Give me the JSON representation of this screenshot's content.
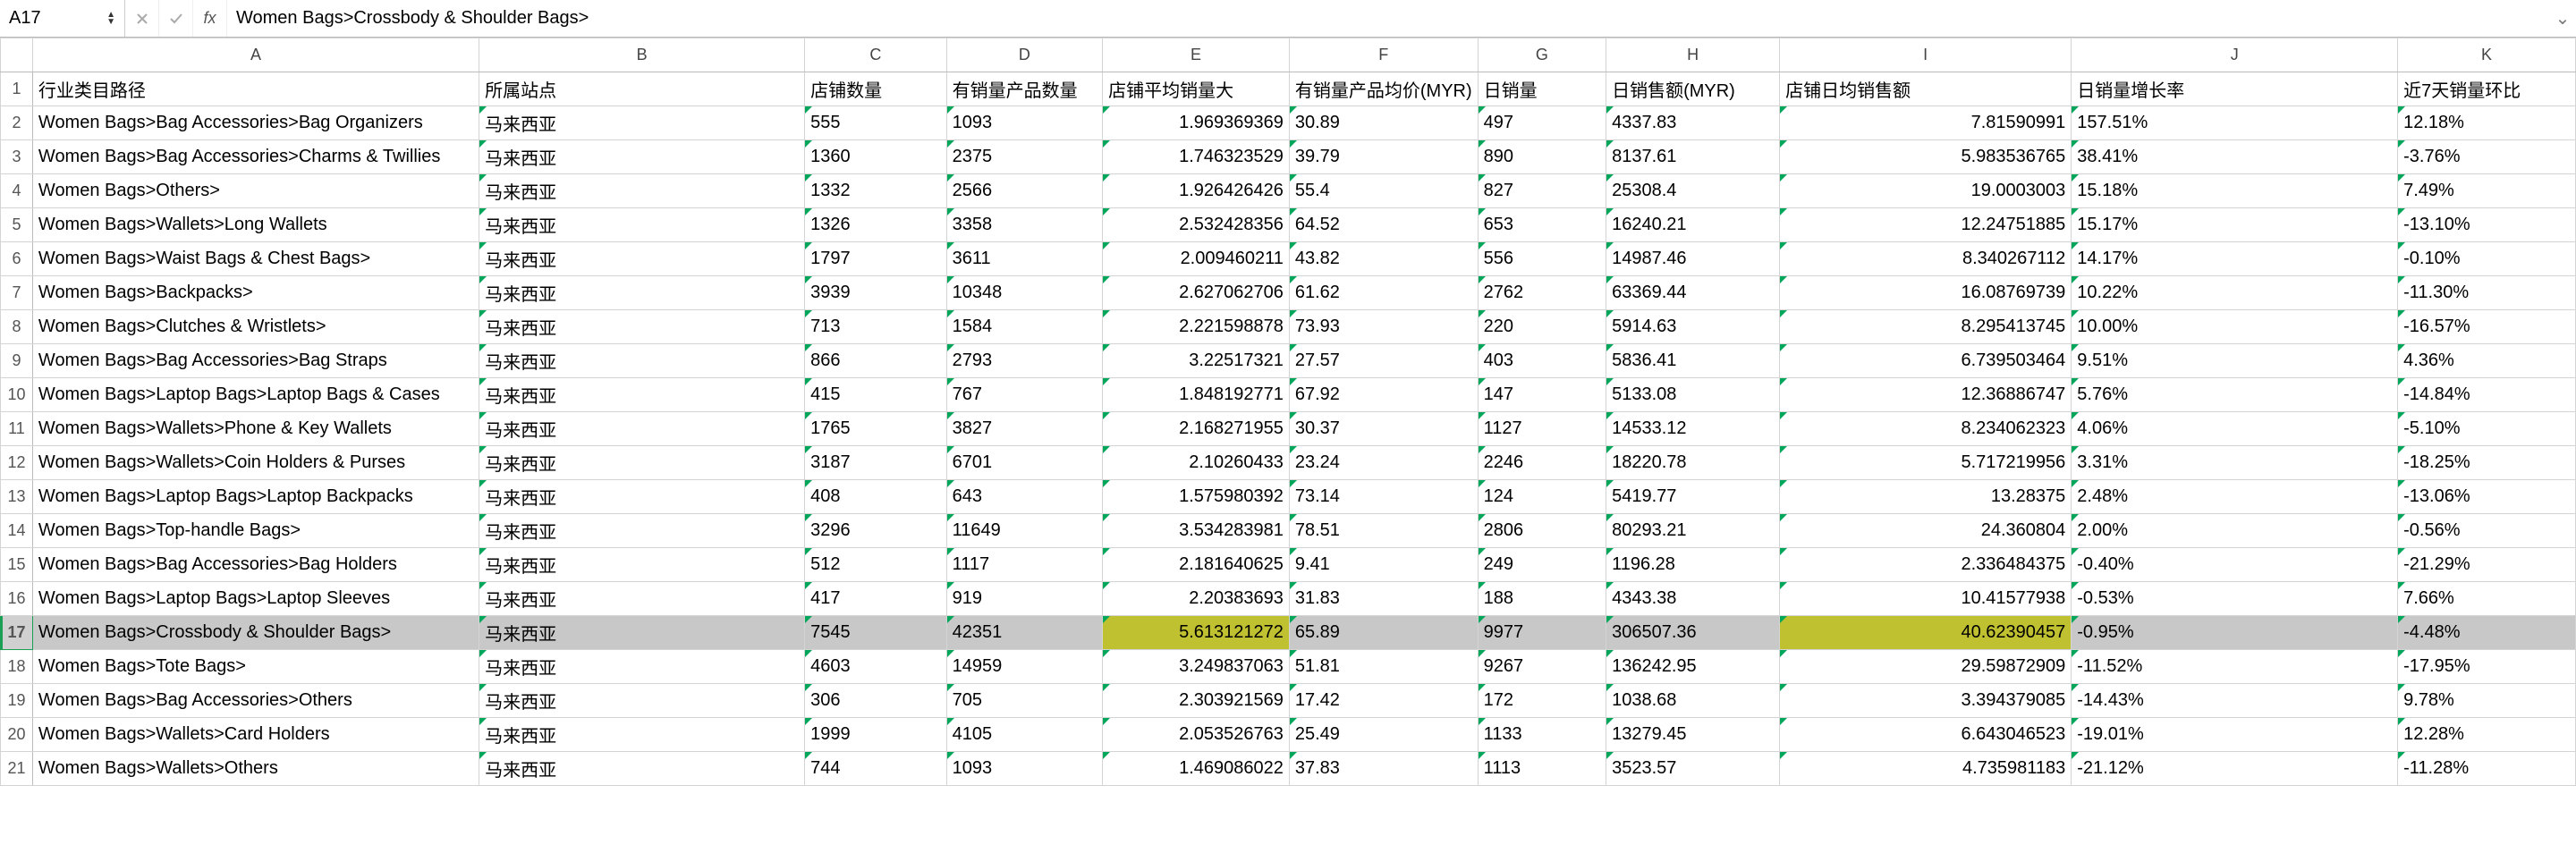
{
  "nameBox": "A17",
  "formula": "Women Bags>Crossbody & Shoulder Bags>",
  "columns": [
    "A",
    "B",
    "C",
    "D",
    "E",
    "F",
    "G",
    "H",
    "I",
    "J",
    "K"
  ],
  "headers": {
    "A": "行业类目路径",
    "B": "所属站点",
    "C": "店铺数量",
    "D": "有销量产品数量",
    "E": "店铺平均销量大",
    "F": "有销量产品均价(MYR)",
    "G": "日销量",
    "H": "日销售额(MYR)",
    "I": "店铺日均销售额",
    "J": "日销量增长率",
    "K": "近7天销量环比"
  },
  "selectedRow": 17,
  "highlightCols": [
    "E",
    "I"
  ],
  "rows": [
    {
      "n": 1,
      "A": "行业类目路径",
      "B": "所属站点",
      "C": "店铺数量",
      "D": "有销量产品数量",
      "E": "店铺平均销量大",
      "F": "有销量产品均价(MYR)",
      "G": "日销量",
      "H": "日销售额(MYR)",
      "I": "店铺日均销售额",
      "J": "日销量增长率",
      "K": "近7天销量环比",
      "isHeader": true
    },
    {
      "n": 2,
      "A": "Women Bags>Bag Accessories>Bag Organizers",
      "B": "马来西亚",
      "C": "555",
      "D": "1093",
      "E": "1.969369369",
      "F": "30.89",
      "G": "497",
      "H": "4337.83",
      "I": "7.81590991",
      "J": "157.51%",
      "K": "12.18%"
    },
    {
      "n": 3,
      "A": "Women Bags>Bag Accessories>Charms & Twillies",
      "B": "马来西亚",
      "C": "1360",
      "D": "2375",
      "E": "1.746323529",
      "F": "39.79",
      "G": "890",
      "H": "8137.61",
      "I": "5.983536765",
      "J": "38.41%",
      "K": "-3.76%"
    },
    {
      "n": 4,
      "A": "Women Bags>Others>",
      "B": "马来西亚",
      "C": "1332",
      "D": "2566",
      "E": "1.926426426",
      "F": "55.4",
      "G": "827",
      "H": "25308.4",
      "I": "19.0003003",
      "J": "15.18%",
      "K": "7.49%"
    },
    {
      "n": 5,
      "A": "Women Bags>Wallets>Long Wallets",
      "B": "马来西亚",
      "C": "1326",
      "D": "3358",
      "E": "2.532428356",
      "F": "64.52",
      "G": "653",
      "H": "16240.21",
      "I": "12.24751885",
      "J": "15.17%",
      "K": "-13.10%"
    },
    {
      "n": 6,
      "A": "Women Bags>Waist Bags & Chest Bags>",
      "B": "马来西亚",
      "C": "1797",
      "D": "3611",
      "E": "2.009460211",
      "F": "43.82",
      "G": "556",
      "H": "14987.46",
      "I": "8.340267112",
      "J": "14.17%",
      "K": "-0.10%"
    },
    {
      "n": 7,
      "A": "Women Bags>Backpacks>",
      "B": "马来西亚",
      "C": "3939",
      "D": "10348",
      "E": "2.627062706",
      "F": "61.62",
      "G": "2762",
      "H": "63369.44",
      "I": "16.08769739",
      "J": "10.22%",
      "K": "-11.30%"
    },
    {
      "n": 8,
      "A": "Women Bags>Clutches & Wristlets>",
      "B": "马来西亚",
      "C": "713",
      "D": "1584",
      "E": "2.221598878",
      "F": "73.93",
      "G": "220",
      "H": "5914.63",
      "I": "8.295413745",
      "J": "10.00%",
      "K": "-16.57%"
    },
    {
      "n": 9,
      "A": "Women Bags>Bag Accessories>Bag Straps",
      "B": "马来西亚",
      "C": "866",
      "D": "2793",
      "E": "3.22517321",
      "F": "27.57",
      "G": "403",
      "H": "5836.41",
      "I": "6.739503464",
      "J": "9.51%",
      "K": "4.36%"
    },
    {
      "n": 10,
      "A": "Women Bags>Laptop Bags>Laptop Bags & Cases",
      "B": "马来西亚",
      "C": "415",
      "D": "767",
      "E": "1.848192771",
      "F": "67.92",
      "G": "147",
      "H": "5133.08",
      "I": "12.36886747",
      "J": "5.76%",
      "K": "-14.84%"
    },
    {
      "n": 11,
      "A": "Women Bags>Wallets>Phone & Key Wallets",
      "B": "马来西亚",
      "C": "1765",
      "D": "3827",
      "E": "2.168271955",
      "F": "30.37",
      "G": "1127",
      "H": "14533.12",
      "I": "8.234062323",
      "J": "4.06%",
      "K": "-5.10%"
    },
    {
      "n": 12,
      "A": "Women Bags>Wallets>Coin Holders & Purses",
      "B": "马来西亚",
      "C": "3187",
      "D": "6701",
      "E": "2.10260433",
      "F": "23.24",
      "G": "2246",
      "H": "18220.78",
      "I": "5.717219956",
      "J": "3.31%",
      "K": "-18.25%"
    },
    {
      "n": 13,
      "A": "Women Bags>Laptop Bags>Laptop Backpacks",
      "B": "马来西亚",
      "C": "408",
      "D": "643",
      "E": "1.575980392",
      "F": "73.14",
      "G": "124",
      "H": "5419.77",
      "I": "13.28375",
      "J": "2.48%",
      "K": "-13.06%"
    },
    {
      "n": 14,
      "A": "Women Bags>Top-handle Bags>",
      "B": "马来西亚",
      "C": "3296",
      "D": "11649",
      "E": "3.534283981",
      "F": "78.51",
      "G": "2806",
      "H": "80293.21",
      "I": "24.360804",
      "J": "2.00%",
      "K": "-0.56%"
    },
    {
      "n": 15,
      "A": "Women Bags>Bag Accessories>Bag Holders",
      "B": "马来西亚",
      "C": "512",
      "D": "1117",
      "E": "2.181640625",
      "F": "9.41",
      "G": "249",
      "H": "1196.28",
      "I": "2.336484375",
      "J": "-0.40%",
      "K": "-21.29%"
    },
    {
      "n": 16,
      "A": "Women Bags>Laptop Bags>Laptop Sleeves",
      "B": "马来西亚",
      "C": "417",
      "D": "919",
      "E": "2.20383693",
      "F": "31.83",
      "G": "188",
      "H": "4343.38",
      "I": "10.41577938",
      "J": "-0.53%",
      "K": "7.66%"
    },
    {
      "n": 17,
      "A": "Women Bags>Crossbody & Shoulder Bags>",
      "B": "马来西亚",
      "C": "7545",
      "D": "42351",
      "E": "5.613121272",
      "F": "65.89",
      "G": "9977",
      "H": "306507.36",
      "I": "40.62390457",
      "J": "-0.95%",
      "K": "-4.48%"
    },
    {
      "n": 18,
      "A": "Women Bags>Tote Bags>",
      "B": "马来西亚",
      "C": "4603",
      "D": "14959",
      "E": "3.249837063",
      "F": "51.81",
      "G": "9267",
      "H": "136242.95",
      "I": "29.59872909",
      "J": "-11.52%",
      "K": "-17.95%"
    },
    {
      "n": 19,
      "A": "Women Bags>Bag Accessories>Others",
      "B": "马来西亚",
      "C": "306",
      "D": "705",
      "E": "2.303921569",
      "F": "17.42",
      "G": "172",
      "H": "1038.68",
      "I": "3.394379085",
      "J": "-14.43%",
      "K": "9.78%"
    },
    {
      "n": 20,
      "A": "Women Bags>Wallets>Card Holders",
      "B": "马来西亚",
      "C": "1999",
      "D": "4105",
      "E": "2.053526763",
      "F": "25.49",
      "G": "1133",
      "H": "13279.45",
      "I": "6.643046523",
      "J": "-19.01%",
      "K": "12.28%"
    },
    {
      "n": 21,
      "A": "Women Bags>Wallets>Others",
      "B": "马来西亚",
      "C": "744",
      "D": "1093",
      "E": "1.469086022",
      "F": "37.83",
      "G": "1113",
      "H": "3523.57",
      "I": "4.735981183",
      "J": "-21.12%",
      "K": "-11.28%"
    }
  ]
}
